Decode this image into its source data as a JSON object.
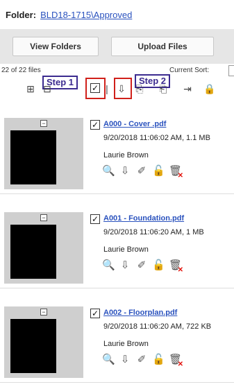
{
  "folder": {
    "label": "Folder:",
    "path": "BLD18-1715\\Approved"
  },
  "buttons": {
    "view_folders": "View Folders",
    "upload_files": "Upload Files"
  },
  "listing": {
    "count": "22 of 22 files",
    "sort_label": "Current Sort:"
  },
  "steps": {
    "step1": "Step 1",
    "step2": "Step 2"
  },
  "toolbar": {
    "expand": "⊞",
    "collapse": "⊟",
    "select_all": "✓",
    "separator": "|",
    "download": "⇩",
    "copy": "⎘",
    "paste": "⎗",
    "move": "⇥",
    "lock": "🔒"
  },
  "files": [
    {
      "name": "A000 - Cover .pdf",
      "meta": "9/20/2018 11:06:02 AM, 1.1 MB",
      "user": "Laurie Brown",
      "checked": true
    },
    {
      "name": "A001 - Foundation.pdf",
      "meta": "9/20/2018 11:06:20 AM, 1 MB",
      "user": "Laurie Brown",
      "checked": true
    },
    {
      "name": "A002 - Floorplan.pdf",
      "meta": "9/20/2018 11:06:20 AM, 722 KB",
      "user": "Laurie Brown",
      "checked": true
    }
  ],
  "file_icons": {
    "preview": "🔍",
    "download": "⇩",
    "annotate": "✐",
    "lock": "🔓",
    "delete": "🗑"
  },
  "colors": {
    "link": "#2a52be",
    "step_border": "#3b2a8f",
    "highlight": "#d0201a",
    "delete_x": "#e3120b"
  }
}
